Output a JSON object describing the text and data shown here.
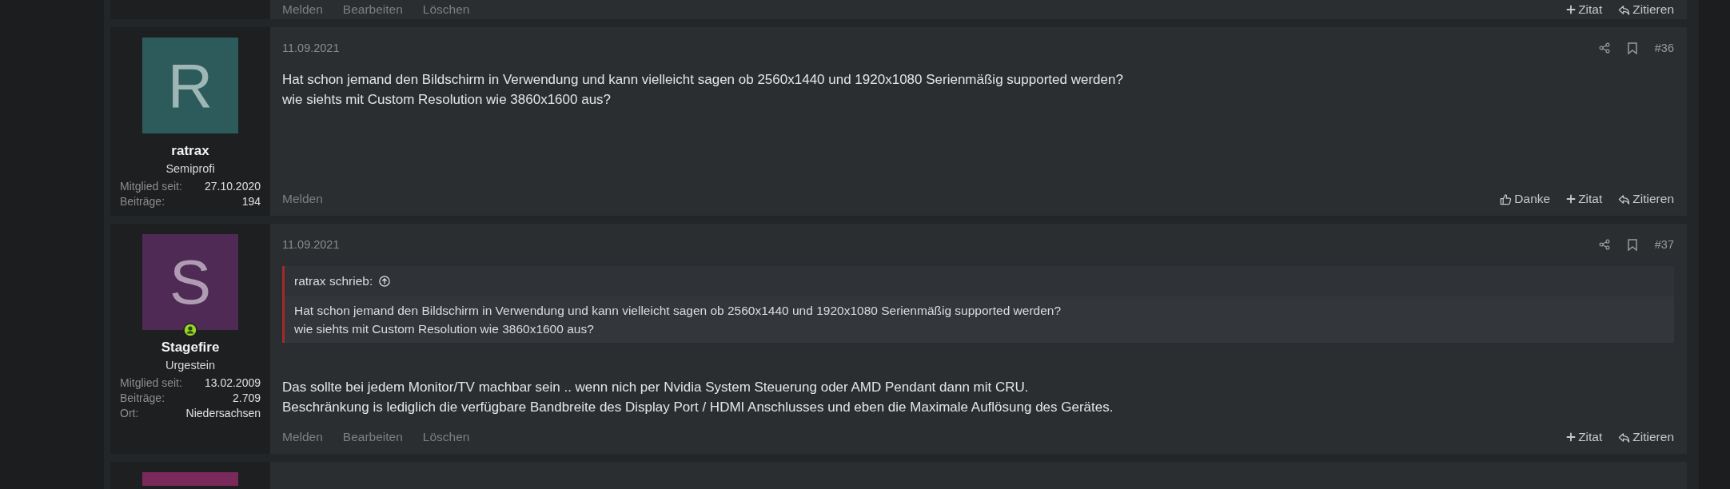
{
  "top_post": {
    "actions_left": [
      "Melden",
      "Bearbeiten",
      "Löschen"
    ],
    "actions_right": [
      {
        "kind": "quote",
        "label": "Zitat"
      },
      {
        "kind": "reply",
        "label": "Zitieren"
      }
    ]
  },
  "posts": [
    {
      "user": {
        "avatar_letter": "R",
        "color": "#2d5a5a",
        "name": "ratrax",
        "title": "Semiprofi",
        "online": false,
        "stats": [
          {
            "label": "Mitglied seit:",
            "value": "27.10.2020"
          },
          {
            "label": "Beiträge:",
            "value": "194"
          }
        ]
      },
      "date": "11.09.2021",
      "number": "#36",
      "body": [
        "Hat schon jemand den Bildschirm in Verwendung und kann vielleicht sagen ob 2560x1440 und 1920x1080 Serienmäßig supported werden?",
        "wie siehts mit Custom Resolution wie 3860x1600 aus?"
      ],
      "actions_left": [
        "Melden"
      ],
      "actions_right": [
        {
          "kind": "like",
          "label": "Danke"
        },
        {
          "kind": "quote",
          "label": "Zitat"
        },
        {
          "kind": "reply",
          "label": "Zitieren"
        }
      ]
    },
    {
      "user": {
        "avatar_letter": "S",
        "color": "#4f2a55",
        "name": "Stagefire",
        "title": "Urgestein",
        "online": true,
        "stats": [
          {
            "label": "Mitglied seit:",
            "value": "13.02.2009"
          },
          {
            "label": "Beiträge:",
            "value": "2.709"
          },
          {
            "label": "Ort:",
            "value": "Niedersachsen"
          }
        ]
      },
      "date": "11.09.2021",
      "number": "#37",
      "quote": {
        "author": "ratrax schrieb:",
        "lines": [
          "Hat schon jemand den Bildschirm in Verwendung und kann vielleicht sagen ob 2560x1440 und 1920x1080 Serienmäßig supported werden?",
          "wie siehts mit Custom Resolution wie 3860x1600 aus?"
        ]
      },
      "body": [
        "Das sollte bei jedem Monitor/TV machbar sein .. wenn nich per Nvidia System Steuerung oder AMD Pendant dann mit CRU.",
        "Beschränkung is lediglich die verfügbare Bandbreite des Display Port / HDMI Anschlusses und eben die Maximale Auflösung des Gerätes."
      ],
      "actions_left": [
        "Melden",
        "Bearbeiten",
        "Löschen"
      ],
      "actions_right": [
        {
          "kind": "quote",
          "label": "Zitat"
        },
        {
          "kind": "reply",
          "label": "Zitieren"
        }
      ]
    }
  ],
  "bottom_post": {
    "color": "#7a2a5a"
  }
}
